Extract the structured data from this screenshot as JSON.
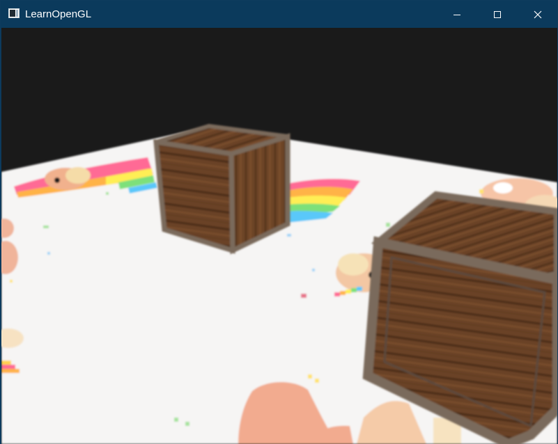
{
  "window": {
    "title": "LearnOpenGL",
    "controls": {
      "minimize_icon": "minimize-icon",
      "maximize_icon": "maximize-icon",
      "close_icon": "close-icon"
    }
  },
  "scene": {
    "clear_color": "#1a1a1a",
    "floor_color": "#f6f5f4",
    "crate_wood": "#6e4628",
    "crate_frame": "#7a6a5c",
    "rainbow_colors": [
      "#ff5b8b",
      "#ffb347",
      "#ffee55",
      "#7de07a",
      "#5ac8fa",
      "#a97cf2"
    ]
  }
}
